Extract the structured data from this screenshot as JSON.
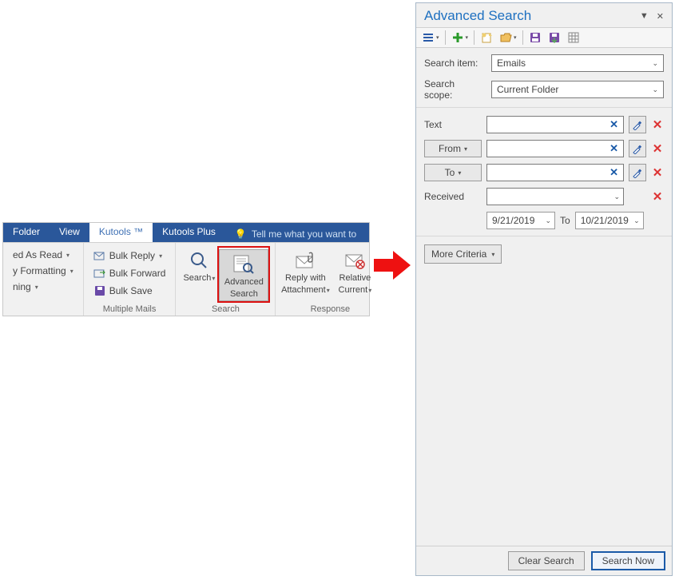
{
  "ribbon": {
    "tabs": {
      "folder": "Folder",
      "view": "View",
      "kutools": "Kutools ™",
      "kutools_plus": "Kutools Plus",
      "tellme": "Tell me what you want to"
    },
    "groups": {
      "col1": {
        "mark_read": "ed As Read",
        "formatting": "y Formatting",
        "ning": "ning"
      },
      "multiple_mails": {
        "label": "Multiple Mails",
        "bulk_reply": "Bulk Reply",
        "bulk_forward": "Bulk Forward",
        "bulk_save": "Bulk Save"
      },
      "search": {
        "label": "Search",
        "search_btn": "Search",
        "advanced_line1": "Advanced",
        "advanced_line2": "Search"
      },
      "response": {
        "label": "Response",
        "reply_line1": "Reply with",
        "reply_line2": "Attachment",
        "relative_line1": "Relative",
        "relative_line2": "Current"
      }
    }
  },
  "panel": {
    "title": "Advanced Search",
    "form": {
      "search_item_label": "Search item:",
      "search_item_value": "Emails",
      "search_scope_label": "Search scope:",
      "search_scope_value": "Current Folder"
    },
    "criteria": {
      "text_label": "Text",
      "from_label": "From",
      "to_label": "To",
      "received_label": "Received",
      "date_from": "9/21/2019",
      "date_to_label": "To",
      "date_to": "10/21/2019"
    },
    "more_criteria": "More Criteria",
    "footer": {
      "clear": "Clear Search",
      "search_now": "Search Now"
    }
  },
  "icons": {
    "menu": "menu-icon",
    "plus": "plus-icon",
    "new": "new-icon",
    "folder": "folder-open-icon",
    "save": "save-icon",
    "export": "export-icon",
    "grid": "grid-icon"
  }
}
